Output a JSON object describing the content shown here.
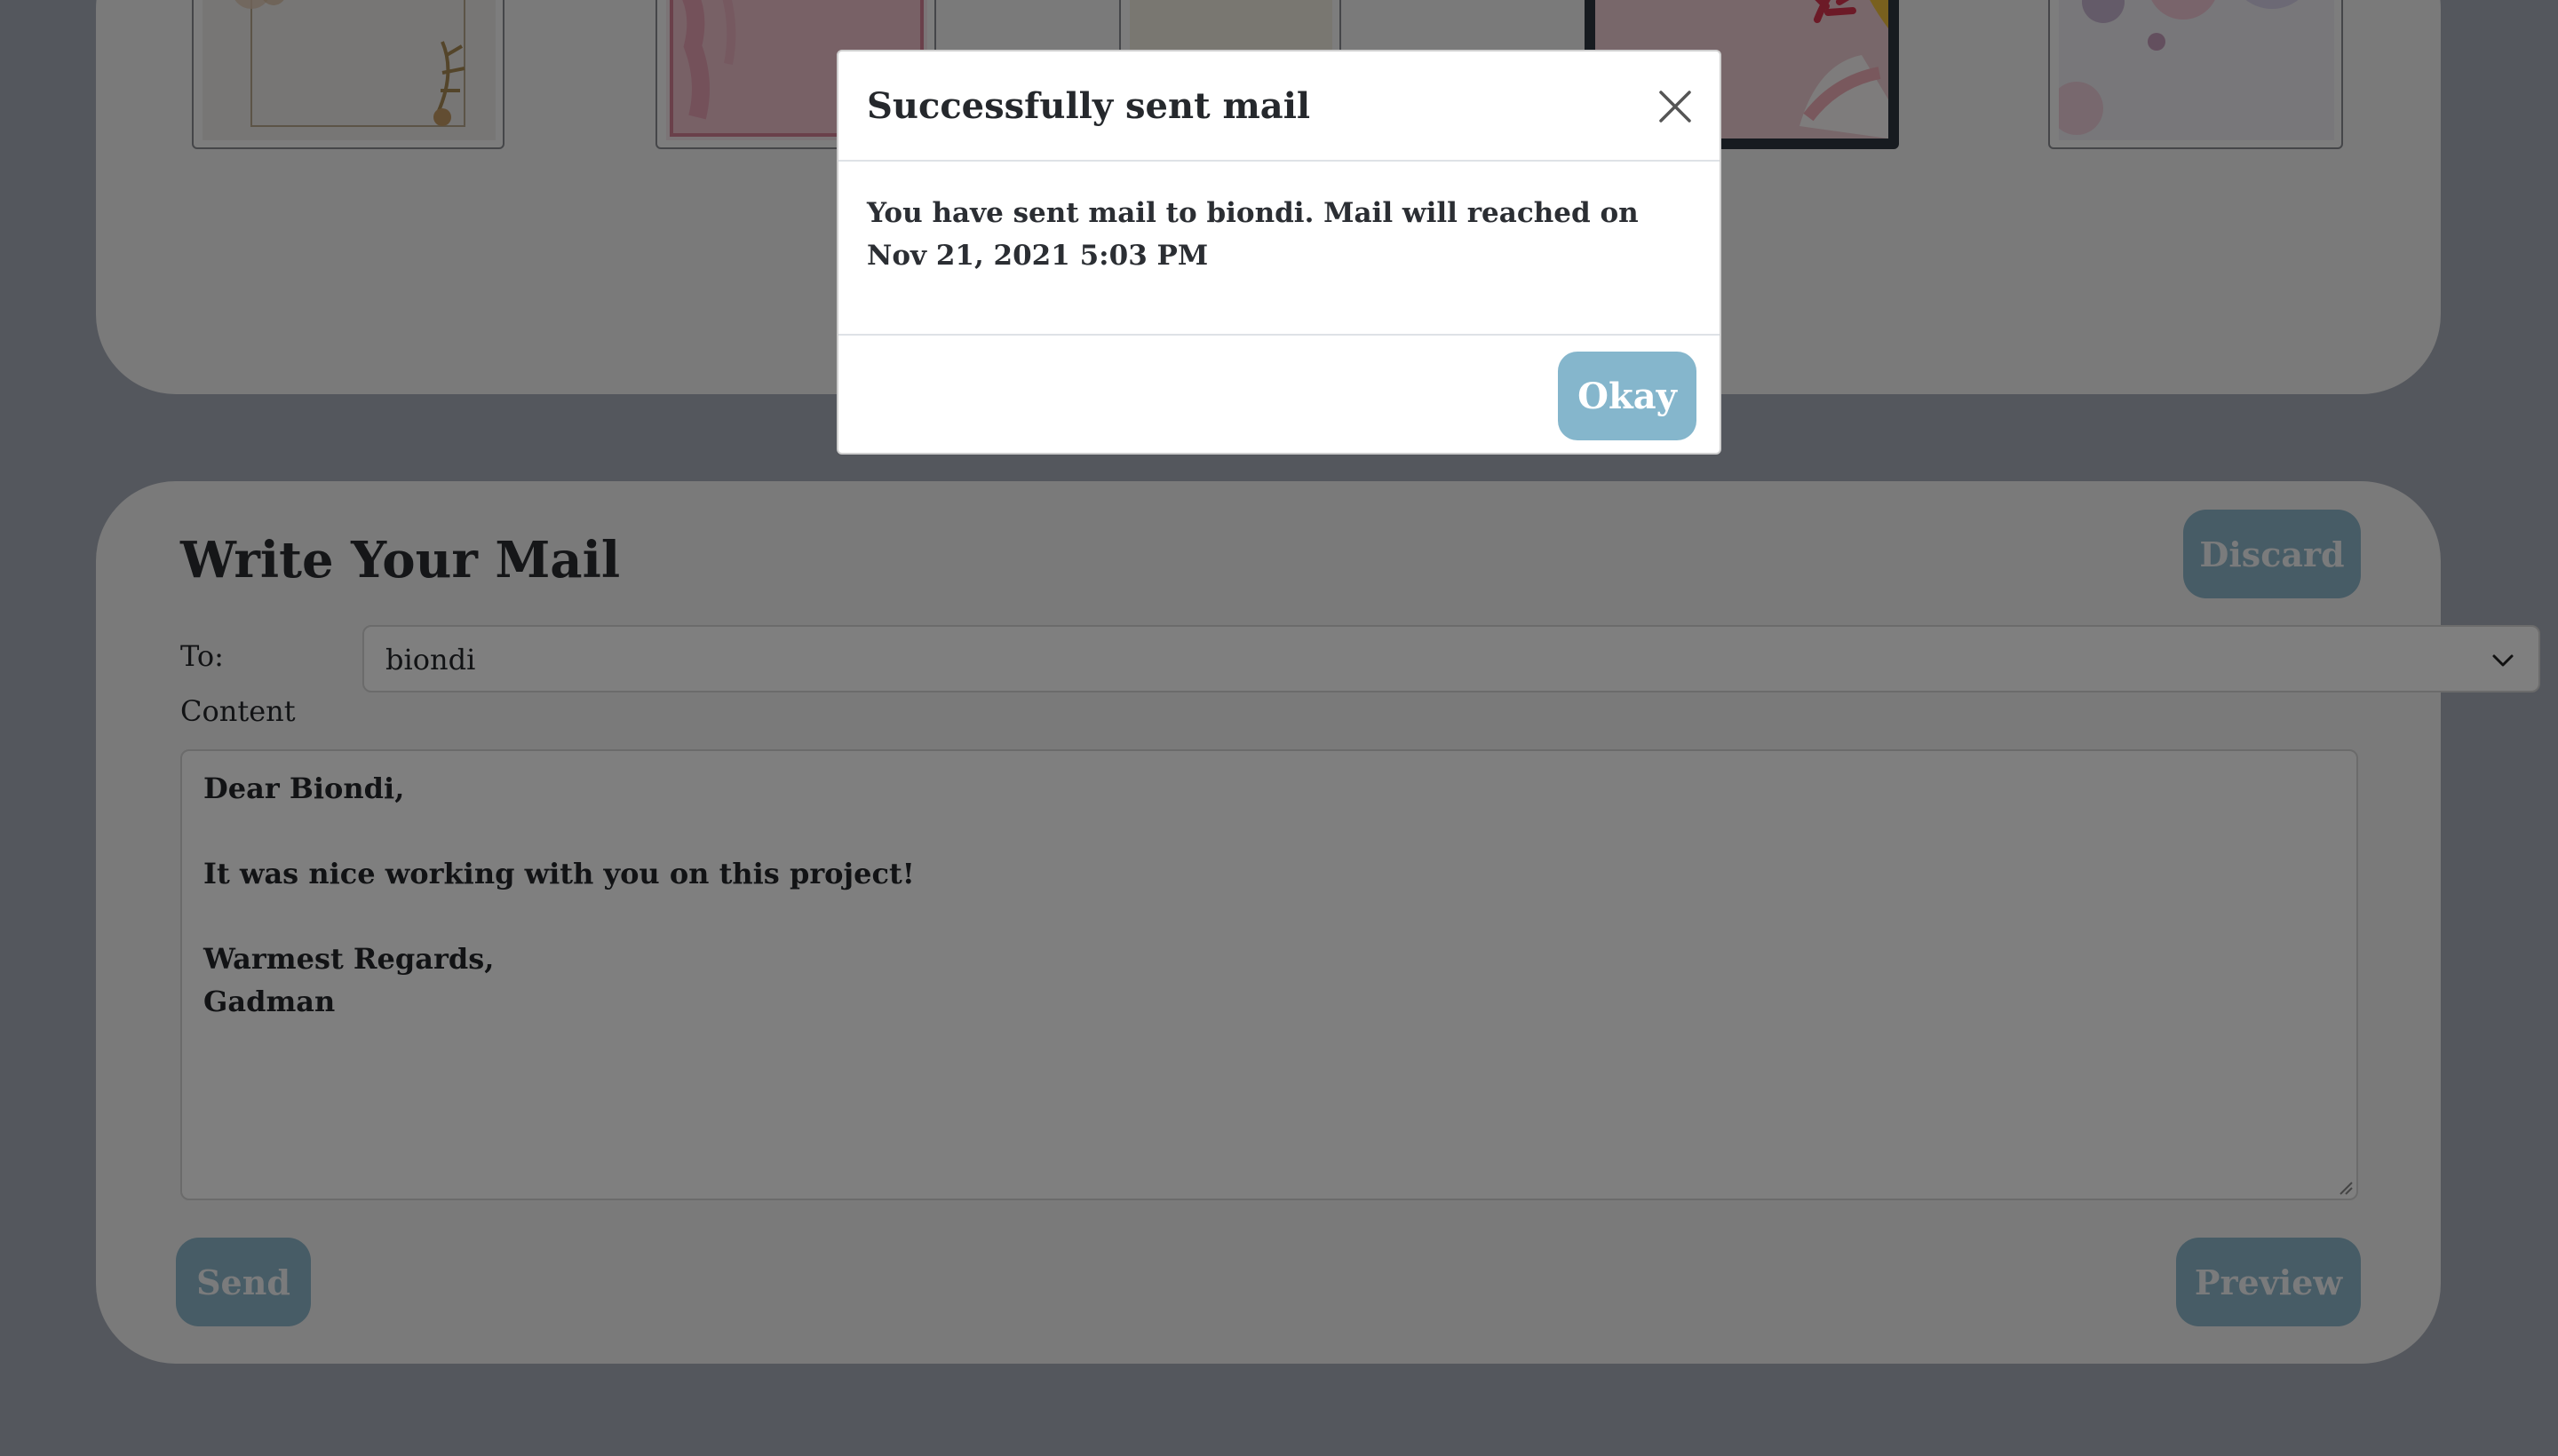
{
  "stationery": {
    "thumbnails": [
      {
        "name": "floral-envelope",
        "selected": false
      },
      {
        "name": "pink-brush",
        "selected": false
      },
      {
        "name": "vintage-floral",
        "selected": false
      },
      {
        "name": "abstract-leaves",
        "selected": true
      },
      {
        "name": "pastel-circles",
        "selected": false
      }
    ]
  },
  "compose": {
    "title": "Write Your Mail",
    "discard_label": "Discard",
    "to_label": "To:",
    "to_value": "biondi",
    "content_label": "Content",
    "content_lines": [
      "Dear Biondi,",
      "",
      "It was nice working with you on this project!",
      "",
      "Warmest Regards,",
      "Gadman"
    ],
    "send_label": "Send",
    "preview_label": "Preview"
  },
  "modal": {
    "title": "Successfully sent mail",
    "message": "You have sent mail to biondi. Mail will reached on Nov 21, 2021 5:03 PM",
    "okay_label": "Okay"
  }
}
